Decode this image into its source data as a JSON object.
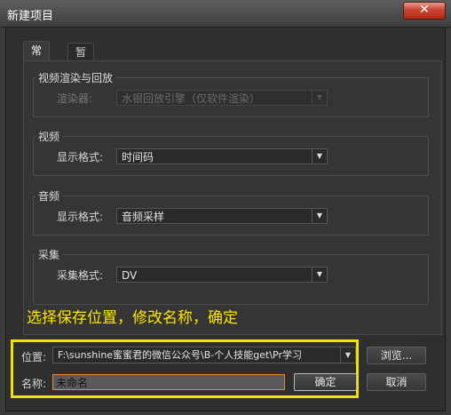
{
  "window": {
    "title": "新建项目",
    "close_glyph": "✕"
  },
  "tabs": [
    {
      "label": "常规",
      "active": true
    },
    {
      "label": "暂存盘",
      "active": false
    }
  ],
  "groups": {
    "render": {
      "title": "视频渲染与回放",
      "label": "渲染器:",
      "value": "水银回放引擎（仅软件渲染）",
      "enabled": false
    },
    "video": {
      "title": "视频",
      "label": "显示格式:",
      "value": "时间码"
    },
    "audio": {
      "title": "音频",
      "label": "显示格式:",
      "value": "音频采样"
    },
    "capture": {
      "title": "采集",
      "label": "采集格式:",
      "value": "DV"
    }
  },
  "annotation": {
    "text": "选择保存位置，修改名称，确定",
    "color": "#ffe600"
  },
  "location": {
    "label": "位置:",
    "value": "F:\\sunshine蜜蜜君的微信公众号\\B-个人技能get\\Pr学习"
  },
  "name": {
    "label": "名称:",
    "value": "未命名"
  },
  "buttons": {
    "browse": "浏览...",
    "ok": "确定",
    "cancel": "取消"
  },
  "icons": {
    "dropdown": "▼"
  }
}
